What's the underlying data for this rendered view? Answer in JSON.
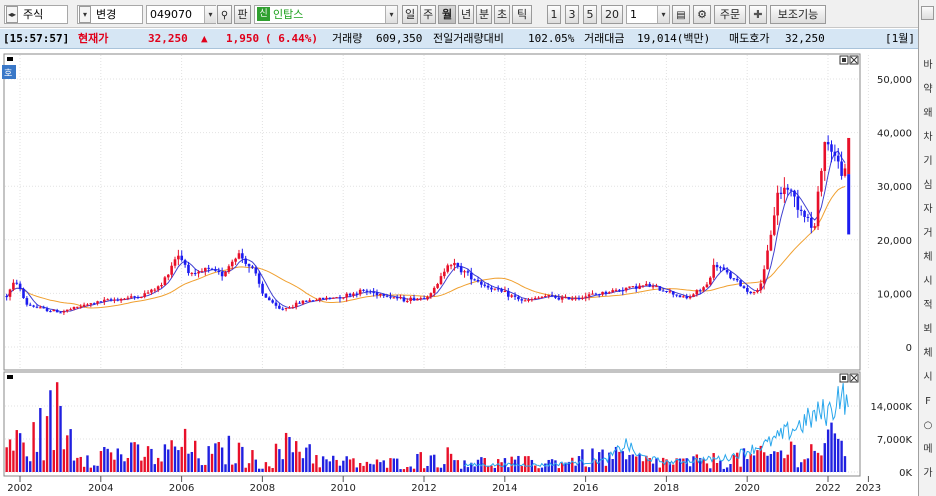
{
  "toolbar": {
    "market": "주식",
    "change_btn": "변경",
    "code": "049070",
    "fan_label": "판",
    "sin_badge": "신",
    "name": "인탑스",
    "periods": [
      "일",
      "주",
      "월",
      "년",
      "분",
      "초",
      "틱"
    ],
    "selected_period": "월",
    "n_buttons": [
      "1",
      "3",
      "5",
      "20"
    ],
    "count_value": "1",
    "order_btn": "주문",
    "aux_btn": "보조기능",
    "colors": {
      "accent_red": "#e0001a",
      "candle_blue": "#1c1cf0",
      "info_bg": "#d6e6f4"
    }
  },
  "info": {
    "time": "[15:57:57]",
    "current_label": "현재가",
    "price": "32,250",
    "change_arrow": "▲",
    "change": "1,950",
    "change_pct": "( 6.44%)",
    "volume_label": "거래량",
    "volume": "609,350",
    "prev_vol_label": "전일거래량대비",
    "prev_vol_pct": "102.05%",
    "amount_label": "거래대금",
    "amount": "19,014(백만)",
    "ask_label": "매도호가",
    "ask": "32,250",
    "period_tag": "[1월]"
  },
  "chart_data": {
    "type": "candlestick",
    "price_axis": {
      "ticks": [
        "50,000",
        "40,000",
        "30,000",
        "20,000",
        "10,000",
        "0"
      ],
      "values": [
        50000,
        40000,
        30000,
        20000,
        10000,
        0
      ]
    },
    "volume_axis": {
      "ticks": [
        "14,000K",
        "7,000K",
        "0K"
      ],
      "values": [
        14000,
        7000,
        0
      ]
    },
    "x_ticks": [
      "2002",
      "2004",
      "2006",
      "2008",
      "2010",
      "2012",
      "2014",
      "2016",
      "2018",
      "2020",
      "2022",
      "2023"
    ],
    "x_tick_years": [
      2002,
      2004,
      2006,
      2008,
      2010,
      2012,
      2014,
      2016,
      2018,
      2020,
      2022,
      2023
    ],
    "price_anchors": [
      [
        2001.67,
        9500
      ],
      [
        2001.9,
        12500
      ],
      [
        2002.15,
        8000
      ],
      [
        2002.6,
        7000
      ],
      [
        2003.0,
        6500
      ],
      [
        2003.5,
        7600
      ],
      [
        2004.0,
        8500
      ],
      [
        2004.5,
        9000
      ],
      [
        2005.0,
        9500
      ],
      [
        2005.5,
        11500
      ],
      [
        2005.9,
        17500
      ],
      [
        2006.3,
        13000
      ],
      [
        2006.6,
        14500
      ],
      [
        2007.0,
        13500
      ],
      [
        2007.4,
        17500
      ],
      [
        2007.8,
        14000
      ],
      [
        2008.0,
        10000
      ],
      [
        2008.4,
        7000
      ],
      [
        2008.7,
        7500
      ],
      [
        2009.0,
        8500
      ],
      [
        2009.5,
        9000
      ],
      [
        2010.0,
        9500
      ],
      [
        2010.5,
        10500
      ],
      [
        2011.0,
        9800
      ],
      [
        2011.5,
        8800
      ],
      [
        2012.0,
        9200
      ],
      [
        2012.3,
        11000
      ],
      [
        2012.6,
        16000
      ],
      [
        2013.0,
        14000
      ],
      [
        2013.5,
        11500
      ],
      [
        2014.0,
        10000
      ],
      [
        2014.5,
        8500
      ],
      [
        2015.0,
        9500
      ],
      [
        2015.5,
        9000
      ],
      [
        2016.0,
        9500
      ],
      [
        2016.5,
        10200
      ],
      [
        2017.0,
        11000
      ],
      [
        2017.5,
        11500
      ],
      [
        2018.0,
        10500
      ],
      [
        2018.5,
        9000
      ],
      [
        2019.0,
        11500
      ],
      [
        2019.2,
        15500
      ],
      [
        2019.6,
        13000
      ],
      [
        2020.0,
        10500
      ],
      [
        2020.2,
        10000
      ],
      [
        2020.4,
        13000
      ],
      [
        2020.75,
        28500
      ],
      [
        2021.0,
        30000
      ],
      [
        2021.3,
        26000
      ],
      [
        2021.5,
        24000
      ],
      [
        2021.65,
        21000
      ],
      [
        2021.9,
        38500
      ],
      [
        2022.1,
        37000
      ],
      [
        2022.3,
        33000
      ],
      [
        2022.5,
        32250
      ]
    ],
    "volume_anchors": [
      [
        2001.7,
        10000
      ],
      [
        2002.2,
        8000
      ],
      [
        2002.9,
        18500
      ],
      [
        2003.5,
        6000
      ],
      [
        2004.5,
        6000
      ],
      [
        2005.5,
        5000
      ],
      [
        2006.0,
        9000
      ],
      [
        2006.5,
        4500
      ],
      [
        2007.2,
        7000
      ],
      [
        2008.0,
        3000
      ],
      [
        2008.9,
        10000
      ],
      [
        2009.5,
        3500
      ],
      [
        2011.0,
        2500
      ],
      [
        2012.5,
        5000
      ],
      [
        2013.5,
        3000
      ],
      [
        2015.0,
        3000
      ],
      [
        2016.5,
        5000
      ],
      [
        2017.5,
        3500
      ],
      [
        2018.5,
        3000
      ],
      [
        2019.5,
        4000
      ],
      [
        2020.5,
        5000
      ],
      [
        2021.0,
        7000
      ],
      [
        2021.5,
        6000
      ],
      [
        2022.0,
        9500
      ],
      [
        2022.5,
        8000
      ]
    ],
    "volume_ma_anchors": [
      [
        2013.0,
        1500
      ],
      [
        2015.0,
        1500
      ],
      [
        2016.5,
        2500
      ],
      [
        2017.0,
        6000
      ],
      [
        2017.3,
        3500
      ],
      [
        2018.0,
        2000
      ],
      [
        2019.5,
        3000
      ],
      [
        2020.0,
        4500
      ],
      [
        2020.5,
        6000
      ],
      [
        2021.0,
        8500
      ],
      [
        2021.5,
        11000
      ],
      [
        2021.8,
        12500
      ],
      [
        2022.1,
        13000
      ],
      [
        2022.3,
        17500
      ],
      [
        2022.5,
        13000
      ]
    ],
    "grid": true
  },
  "rightstrip": {
    "chars": [
      "바",
      "약",
      "왜",
      "차",
      "기",
      "심",
      "자",
      "거",
      "체",
      "시",
      "적",
      "뵈",
      "체",
      "시",
      "F",
      "○",
      "메",
      "가"
    ]
  }
}
